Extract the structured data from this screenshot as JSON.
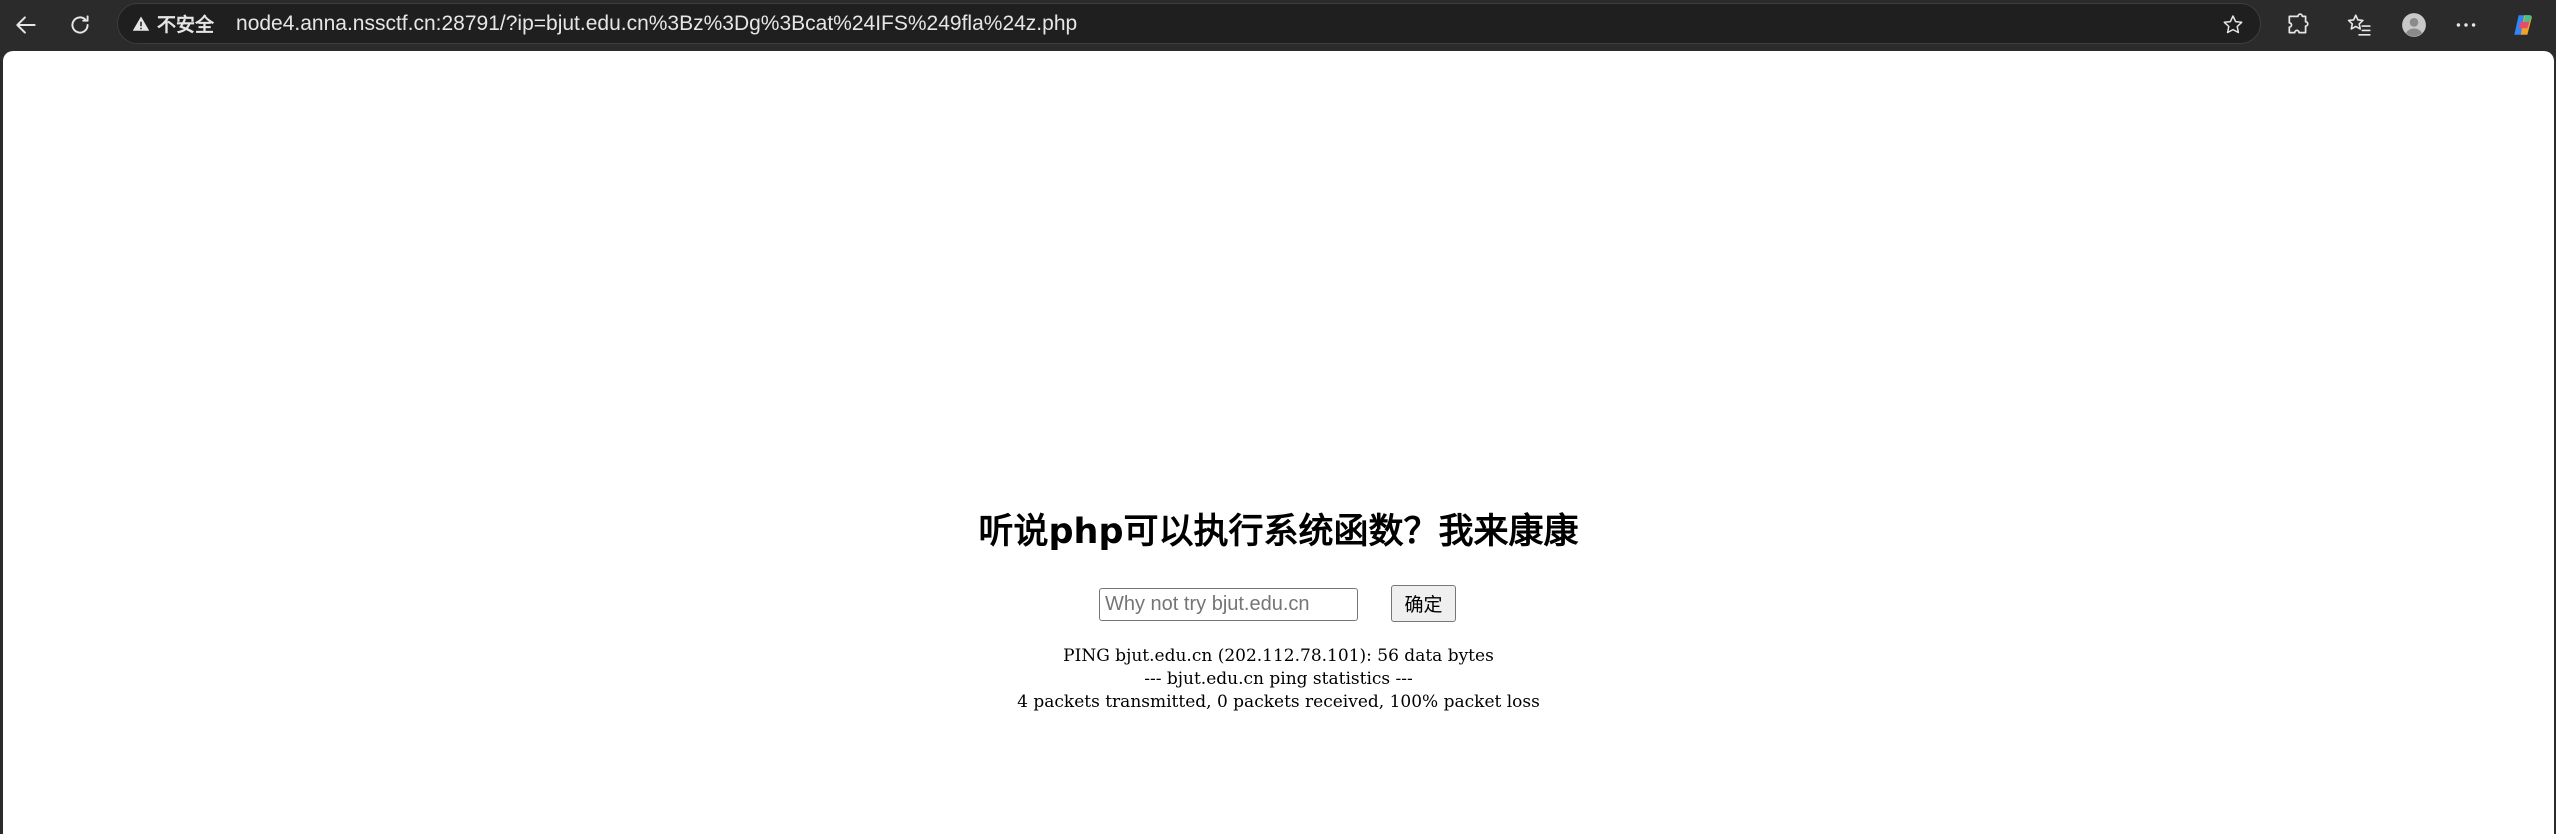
{
  "browser": {
    "security_label": "不安全",
    "url": "node4.anna.nssctf.cn:28791/?ip=bjut.edu.cn%3Bz%3Dg%3Bcat%24IFS%249fla%24z.php",
    "icons": {
      "back": "back-arrow-icon",
      "reload": "reload-icon",
      "warning": "warning-icon",
      "favorite": "star-icon",
      "extensions": "puzzle-icon",
      "favorites": "favorites-icon",
      "profile": "profile-avatar-icon",
      "more": "more-icon",
      "copilot": "copilot-icon"
    },
    "colors": {
      "chrome_bg": "#2b2b2b",
      "address_bg": "#1f1f1f",
      "text": "#e6e6e6"
    }
  },
  "page": {
    "title": "听说php可以执行系统函数？我来康康",
    "input": {
      "placeholder": "Why not try bjut.edu.cn",
      "value": ""
    },
    "submit_label": "确定",
    "output_lines": [
      "PING bjut.edu.cn (202.112.78.101): 56 data bytes",
      "--- bjut.edu.cn ping statistics ---",
      "4 packets transmitted, 0 packets received, 100% packet loss"
    ]
  }
}
